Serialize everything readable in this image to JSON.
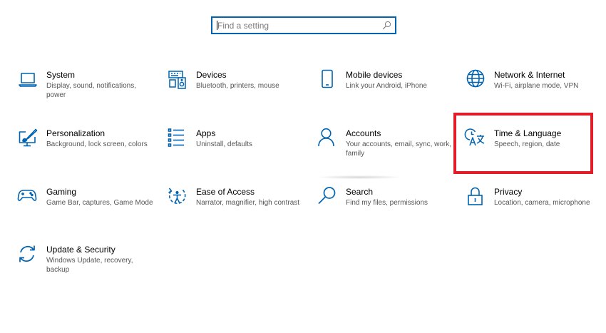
{
  "search": {
    "placeholder": "Find a setting",
    "value": ""
  },
  "colors": {
    "accent": "#0063b1",
    "highlight": "#e11d2a"
  },
  "tiles": [
    {
      "title": "System",
      "desc": "Display, sound, notifications, power",
      "icon": "laptop-icon"
    },
    {
      "title": "Devices",
      "desc": "Bluetooth, printers, mouse",
      "icon": "keyboard-speaker-icon"
    },
    {
      "title": "Mobile devices",
      "desc": "Link your Android, iPhone",
      "icon": "phone-icon"
    },
    {
      "title": "Network & Internet",
      "desc": "Wi-Fi, airplane mode, VPN",
      "icon": "globe-icon"
    },
    {
      "title": "Personalization",
      "desc": "Background, lock screen, colors",
      "icon": "paintbrush-monitor-icon"
    },
    {
      "title": "Apps",
      "desc": "Uninstall, defaults",
      "icon": "apps-list-icon"
    },
    {
      "title": "Accounts",
      "desc": "Your accounts, email, sync, work, family",
      "icon": "person-icon"
    },
    {
      "title": "Time & Language",
      "desc": "Speech, region, date",
      "icon": "time-language-icon"
    },
    {
      "title": "Gaming",
      "desc": "Game Bar, captures, Game Mode",
      "icon": "gamepad-icon"
    },
    {
      "title": "Ease of Access",
      "desc": "Narrator, magnifier, high contrast",
      "icon": "ease-of-access-icon"
    },
    {
      "title": "Search",
      "desc": "Find my files, permissions",
      "icon": "magnifier-icon"
    },
    {
      "title": "Privacy",
      "desc": "Location, camera, microphone",
      "icon": "lock-icon"
    },
    {
      "title": "Update & Security",
      "desc": "Windows Update, recovery, backup",
      "icon": "sync-arrows-icon"
    }
  ]
}
